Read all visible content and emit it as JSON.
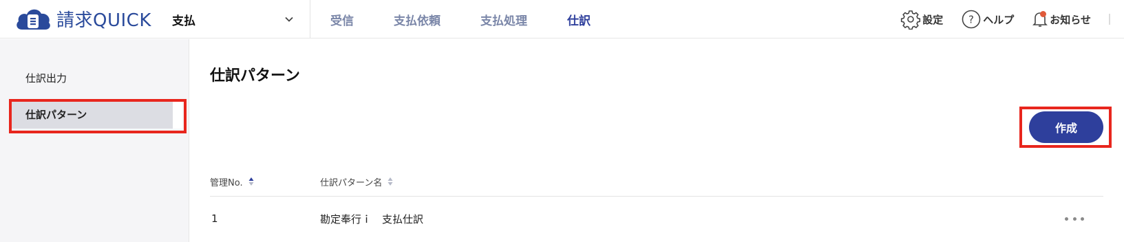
{
  "header": {
    "logo_text": "請求QUICK",
    "service_select": "支払",
    "nav": [
      "受信",
      "支払依頼",
      "支払処理",
      "仕訳"
    ],
    "active_nav": "仕訳",
    "tools": {
      "settings_label": "設定",
      "help_label": "ヘルプ",
      "notice_label": "お知らせ"
    }
  },
  "sidebar": {
    "items": [
      {
        "label": "仕訳出力"
      },
      {
        "label": "仕訳パターン"
      }
    ],
    "active_item": "仕訳パターン"
  },
  "main": {
    "title": "仕訳パターン",
    "create_label": "作成",
    "table": {
      "headers": [
        "管理No.",
        "仕訳パターン名"
      ],
      "rows": [
        {
          "no": "1",
          "name": "勘定奉行ｉ　支払仕訳"
        }
      ]
    }
  },
  "colors": {
    "brand": "#2e3f9c",
    "logo": "#2a4a9b",
    "highlight": "#e8261d",
    "notification": "#e05a3a"
  }
}
